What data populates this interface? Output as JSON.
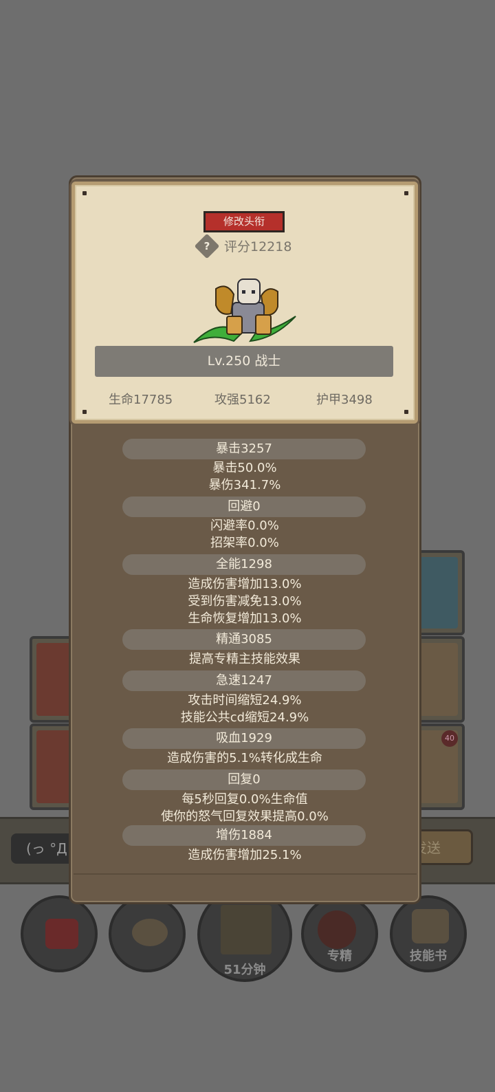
{
  "background": {
    "chat_placeholder": "(っ °Д",
    "send_label": "发送",
    "bottom_buttons": [
      {
        "label": "",
        "icon": "potion-icon"
      },
      {
        "label": "",
        "icon": "bread-icon"
      },
      {
        "label": "51分钟",
        "icon": "treasure-chest-icon"
      },
      {
        "label": "专精",
        "icon": "specialization-icon"
      },
      {
        "label": "技能书",
        "icon": "skill-book-icon"
      }
    ],
    "card_badge": "40"
  },
  "panel": {
    "rename_label": "修改头衔",
    "help_glyph": "?",
    "score": "评分12218",
    "level_class": "Lv.250 战士",
    "base_stats": {
      "life": "生命17785",
      "attack": "攻强5162",
      "armor": "护甲3498"
    }
  },
  "stats": [
    {
      "header": "暴击3257",
      "lines": [
        "暴击50.0%",
        "暴伤341.7%"
      ]
    },
    {
      "header": "回避0",
      "lines": [
        "闪避率0.0%",
        "招架率0.0%"
      ]
    },
    {
      "header": "全能1298",
      "lines": [
        "造成伤害增加13.0%",
        "受到伤害减免13.0%",
        "生命恢复增加13.0%"
      ]
    },
    {
      "header": "精通3085",
      "lines": [
        "提高专精主技能效果"
      ]
    },
    {
      "header": "急速1247",
      "lines": [
        "攻击时间缩短24.9%",
        "技能公共cd缩短24.9%"
      ]
    },
    {
      "header": "吸血1929",
      "lines": [
        "造成伤害的5.1%转化成生命"
      ]
    },
    {
      "header": "回复0",
      "lines": [
        "每5秒回复0.0%生命值",
        "使你的怒气回复效果提高0.0%"
      ]
    },
    {
      "header": "增伤1884",
      "lines": [
        "造成伤害增加25.1%"
      ]
    }
  ],
  "colors": {
    "rename_button": "#b5302b",
    "parchment": "#e8dcbf",
    "panel": "#6a5a48"
  }
}
